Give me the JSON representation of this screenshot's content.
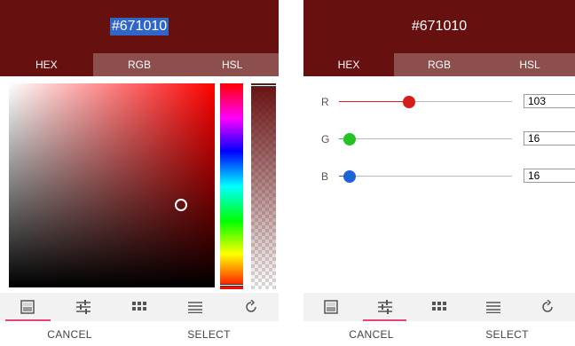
{
  "hex_value": "#671010",
  "tabs": [
    {
      "label": "HEX"
    },
    {
      "label": "RGB"
    },
    {
      "label": "HSL"
    }
  ],
  "picker": {
    "hue_fraction": 0.0,
    "saturation_fraction": 0.84,
    "value_fraction": 0.4,
    "alpha_fraction": 1.0
  },
  "rgb": {
    "r": {
      "label": "R",
      "value": "103",
      "fraction": 0.404,
      "color": "#d41d1d"
    },
    "g": {
      "label": "G",
      "value": "16",
      "fraction": 0.063,
      "color": "#25c225"
    },
    "b": {
      "label": "B",
      "value": "16",
      "fraction": 0.063,
      "color": "#1d63d8"
    }
  },
  "toolbar_icons": [
    "palette-icon",
    "sliders-icon",
    "swatches-grid-icon",
    "list-icon",
    "history-icon"
  ],
  "actions": {
    "cancel": "CANCEL",
    "select": "SELECT"
  },
  "colors": {
    "header_bg": "#671010",
    "inactive_tab_bg": "#8d4e4e",
    "active_indicator": "#e0457b"
  }
}
